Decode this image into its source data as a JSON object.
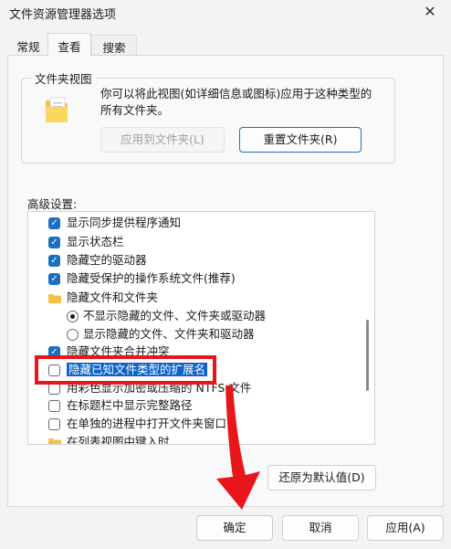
{
  "window": {
    "title": "文件资源管理器选项"
  },
  "tabs": [
    {
      "label": "常规"
    },
    {
      "label": "查看"
    },
    {
      "label": "搜索"
    }
  ],
  "folder_views": {
    "title": "文件夹视图",
    "description": "你可以将此视图(如详细信息或图标)应用于这种类型的所有文件夹。",
    "apply_button": "应用到文件夹(L)",
    "reset_button": "重置文件夹(R)"
  },
  "advanced": {
    "label": "高级设置:",
    "items": [
      {
        "type": "checkbox",
        "checked": true,
        "label": "显示同步提供程序通知"
      },
      {
        "type": "checkbox",
        "checked": true,
        "label": "显示状态栏"
      },
      {
        "type": "checkbox",
        "checked": true,
        "label": "隐藏空的驱动器"
      },
      {
        "type": "checkbox",
        "checked": true,
        "label": "隐藏受保护的操作系统文件(推荐)"
      },
      {
        "type": "folder",
        "label": "隐藏文件和文件夹"
      },
      {
        "type": "radio",
        "selected": true,
        "label": "不显示隐藏的文件、文件夹或驱动器"
      },
      {
        "type": "radio",
        "selected": false,
        "label": "显示隐藏的文件、文件夹和驱动器"
      },
      {
        "type": "checkbox",
        "checked": true,
        "label": "隐藏文件夹合并冲突"
      },
      {
        "type": "checkbox",
        "checked": false,
        "label": "隐藏已知文件类型的扩展名"
      },
      {
        "type": "checkbox",
        "checked": false,
        "label": "用彩色显示加密或压缩的 NTFS 文件"
      },
      {
        "type": "checkbox",
        "checked": false,
        "label": "在标题栏中显示完整路径"
      },
      {
        "type": "checkbox",
        "checked": false,
        "label": "在单独的进程中打开文件夹窗口"
      },
      {
        "type": "folder",
        "label": "在列表视图中键入时"
      }
    ],
    "restore_button": "还原为默认值(D)"
  },
  "footer": {
    "ok": "确定",
    "cancel": "取消",
    "apply": "应用(A)"
  },
  "colors": {
    "accent": "#0f63c9",
    "annotation": "#e8161b"
  }
}
